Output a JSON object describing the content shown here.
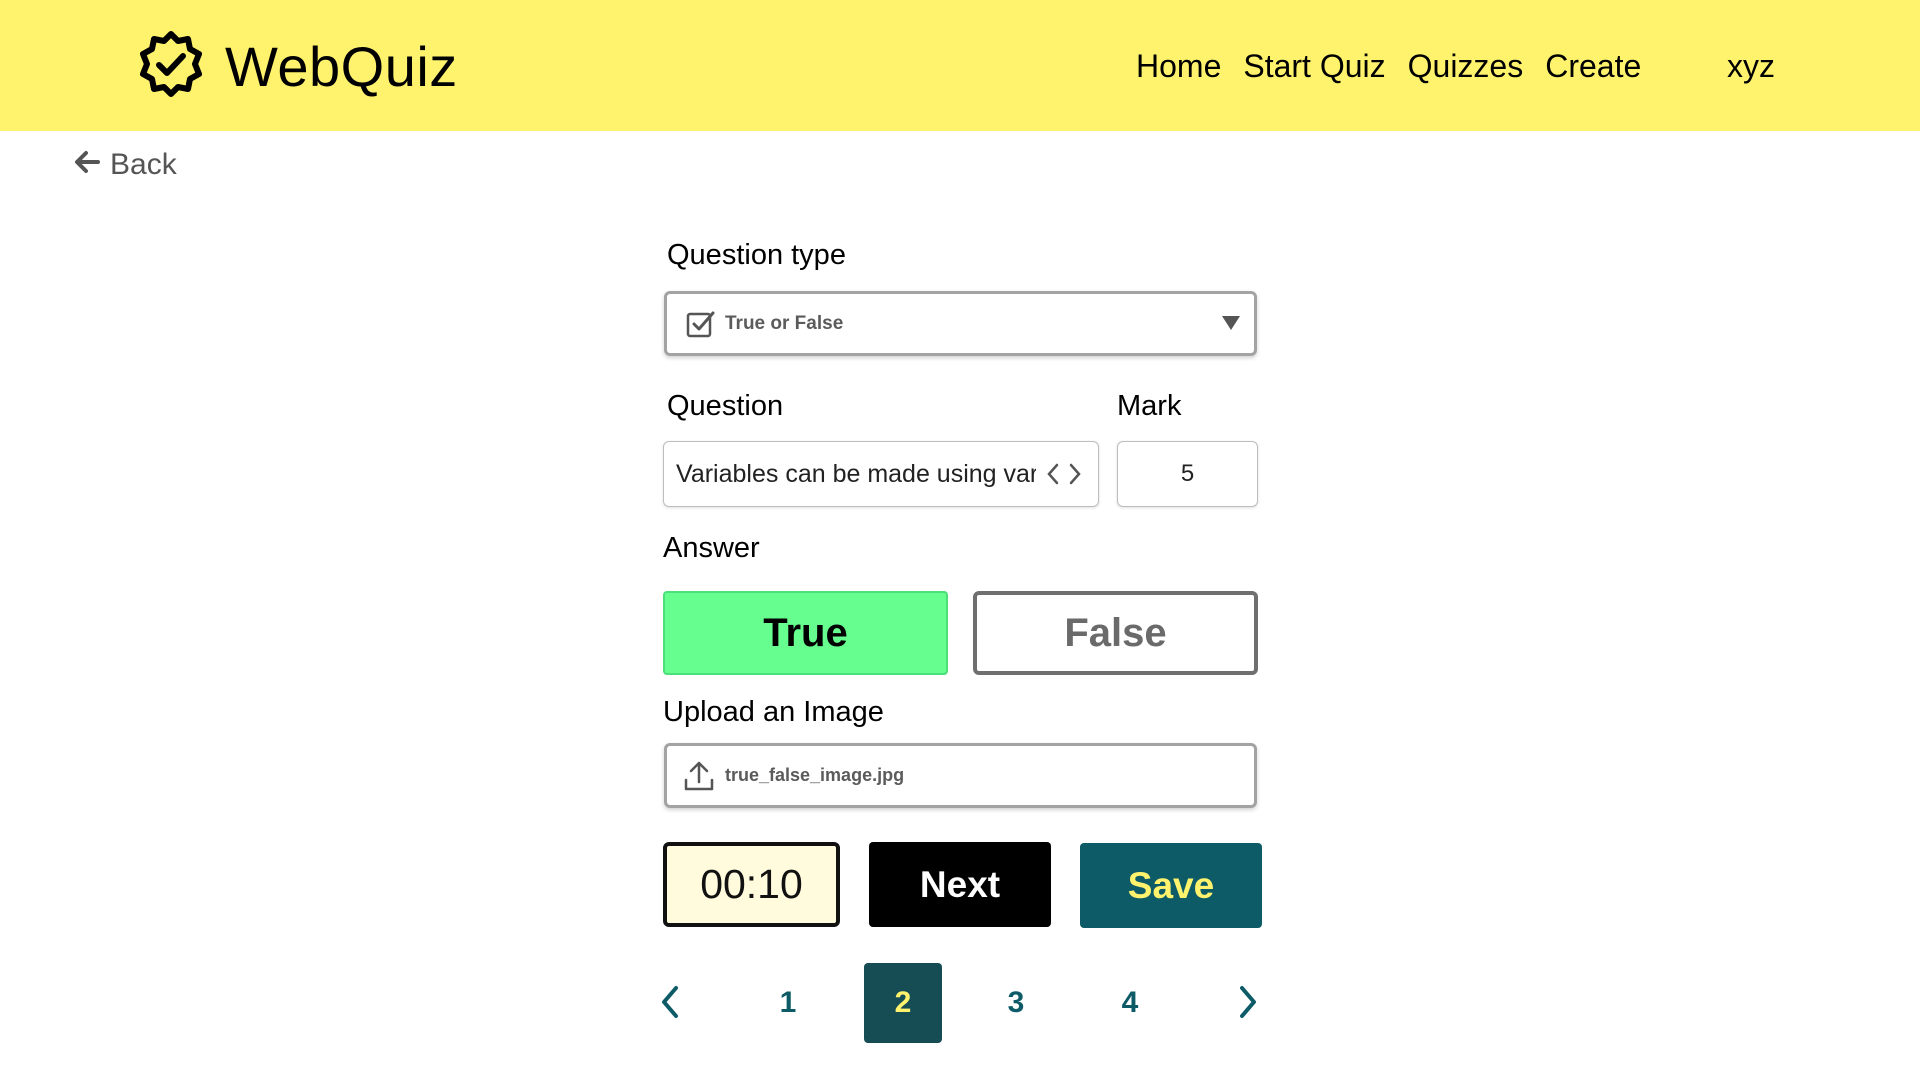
{
  "header": {
    "brand_title": "WebQuiz",
    "brand_icon": "verified-badge-icon",
    "nav": [
      "Home",
      "Start Quiz",
      "Quizzes",
      "Create"
    ],
    "user": "xyz",
    "background_color": "#fff36e"
  },
  "back": {
    "label": "Back",
    "icon": "arrow-left-icon"
  },
  "form": {
    "question_type_label": "Question type",
    "question_type_value": "True or False",
    "question_type_icon": "checkbox-icon",
    "question_label": "Question",
    "question_value": "Variables can be made using var",
    "mark_label": "Mark",
    "mark_value": "5",
    "answer_label": "Answer",
    "answer_true": "True",
    "answer_false": "False",
    "selected_answer": "True",
    "upload_label": "Upload an Image",
    "upload_file": "true_false_image.jpg",
    "upload_icon": "upload-icon"
  },
  "actions": {
    "timer": "00:10",
    "next": "Next",
    "save": "Save"
  },
  "pagination": {
    "pages": [
      "1",
      "2",
      "3",
      "4"
    ],
    "current": "2"
  },
  "colors": {
    "accent_yellow": "#fff36e",
    "true_green": "#66ff8f",
    "teal": "#0d5b66",
    "active_page": "#164d55",
    "timer_bg": "#fffbdc"
  }
}
